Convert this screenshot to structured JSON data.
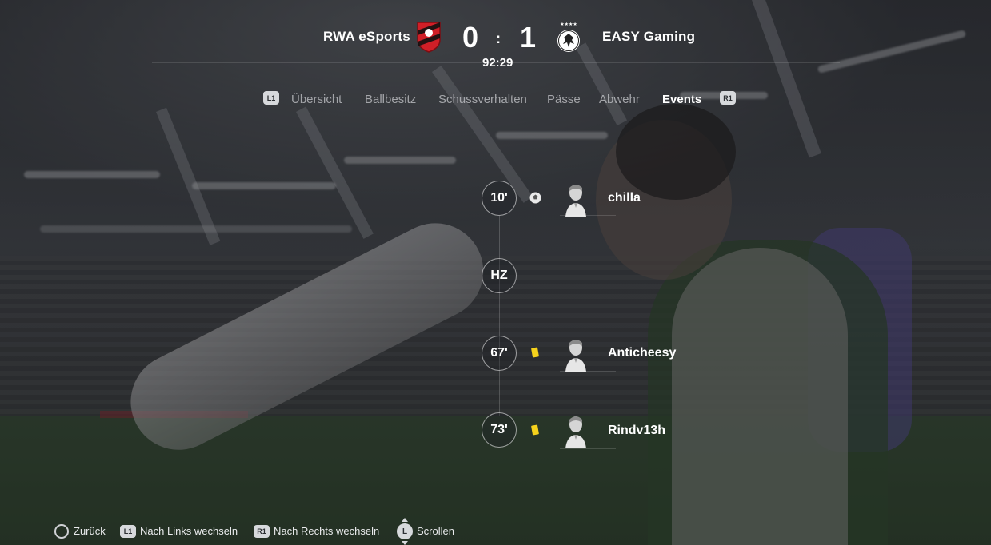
{
  "match": {
    "home_team": "RWA eSports",
    "away_team": "EASY Gaming",
    "home_score": "0",
    "away_score": "1",
    "separator": ":",
    "clock": "92:29"
  },
  "tabs": {
    "left_hint": "L1",
    "right_hint": "R1",
    "items": [
      "Übersicht",
      "Ballbesitz",
      "Schussverhalten",
      "Pässe",
      "Abwehr",
      "Events"
    ],
    "active": "Events"
  },
  "events": [
    {
      "minute": "10'",
      "type": "goal-icon",
      "player": "chilla"
    },
    {
      "minute": "HZ"
    },
    {
      "minute": "67'",
      "type": "yellow-card-icon",
      "player": "Anticheesy"
    },
    {
      "minute": "73'",
      "type": "yellow-card-icon",
      "player": "Rindv13h"
    }
  ],
  "colors": {
    "yellow_card": "#f5d21c",
    "home_crest": "#d01f27"
  },
  "footer": {
    "back": "Zurück",
    "l1": "L1",
    "left": "Nach Links wechseln",
    "r1": "R1",
    "right": "Nach Rechts wechseln",
    "stick": "L",
    "scroll": "Scrollen"
  }
}
